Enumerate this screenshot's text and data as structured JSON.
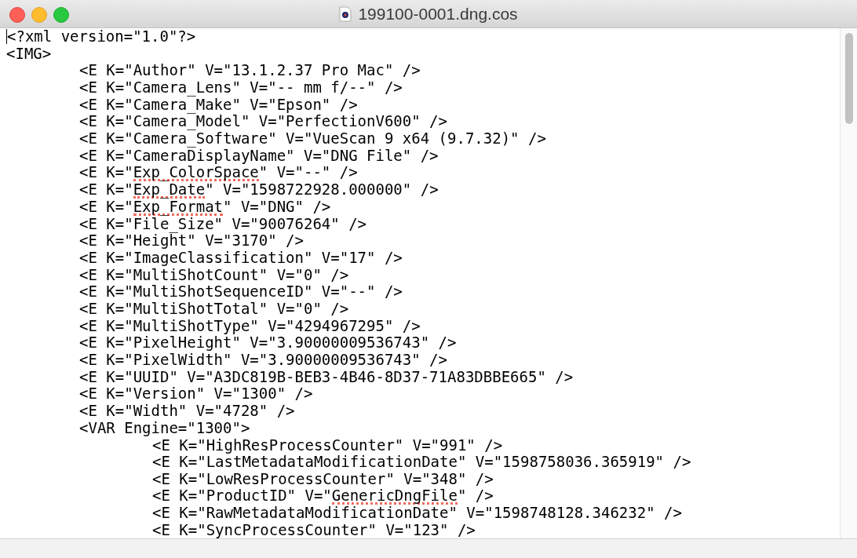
{
  "window": {
    "title": "199100-0001.dng.cos"
  },
  "document": {
    "lines": [
      {
        "text": "<?xml version=\"1.0\"?>"
      },
      {
        "text": "<IMG>",
        "children": [
          {
            "text": "<E K=\"Author\" V=\"13.1.2.37 Pro Mac\" />"
          },
          {
            "text": "<E K=\"Camera_Lens\" V=\"-- mm f/--\" />"
          },
          {
            "text": "<E K=\"Camera_Make\" V=\"Epson\" />"
          },
          {
            "text": "<E K=\"Camera_Model\" V=\"PerfectionV600\" />"
          },
          {
            "text": "<E K=\"Camera_Software\" V=\"VueScan 9 x64 (9.7.32)\" />"
          },
          {
            "text": "<E K=\"CameraDisplayName\" V=\"DNG File\" />"
          },
          {
            "parts": [
              {
                "text": "<E K=\"",
                "flagged": false
              },
              {
                "text": "Exp_ColorSpace",
                "flagged": true
              },
              {
                "text": "\" V=\"--\" />",
                "flagged": false
              }
            ]
          },
          {
            "parts": [
              {
                "text": "<E K=\"",
                "flagged": false
              },
              {
                "text": "Exp_Date",
                "flagged": true
              },
              {
                "text": "\" V=\"1598722928.000000\" />",
                "flagged": false
              }
            ]
          },
          {
            "parts": [
              {
                "text": "<E K=\"",
                "flagged": false
              },
              {
                "text": "Exp_Format",
                "flagged": true
              },
              {
                "text": "\" V=\"DNG\" />",
                "flagged": false
              }
            ]
          },
          {
            "text": "<E K=\"File_Size\" V=\"90076264\" />"
          },
          {
            "text": "<E K=\"Height\" V=\"3170\" />"
          },
          {
            "text": "<E K=\"ImageClassification\" V=\"17\" />"
          },
          {
            "text": "<E K=\"MultiShotCount\" V=\"0\" />"
          },
          {
            "text": "<E K=\"MultiShotSequenceID\" V=\"--\" />"
          },
          {
            "text": "<E K=\"MultiShotTotal\" V=\"0\" />"
          },
          {
            "text": "<E K=\"MultiShotType\" V=\"4294967295\" />"
          },
          {
            "text": "<E K=\"PixelHeight\" V=\"3.90000009536743\" />"
          },
          {
            "text": "<E K=\"PixelWidth\" V=\"3.90000009536743\" />"
          },
          {
            "text": "<E K=\"UUID\" V=\"A3DC819B-BEB3-4B46-8D37-71A83DBBE665\" />"
          },
          {
            "text": "<E K=\"Version\" V=\"1300\" />"
          },
          {
            "text": "<E K=\"Width\" V=\"4728\" />"
          },
          {
            "text": "<VAR Engine=\"1300\">",
            "children": [
              {
                "text": "<E K=\"HighResProcessCounter\" V=\"991\" />"
              },
              {
                "text": "<E K=\"LastMetadataModificationDate\" V=\"1598758036.365919\" />"
              },
              {
                "text": "<E K=\"LowResProcessCounter\" V=\"348\" />"
              },
              {
                "parts": [
                  {
                    "text": "<E K=\"ProductID\" V=\"",
                    "flagged": false
                  },
                  {
                    "text": "GenericDngFile",
                    "flagged": true
                  },
                  {
                    "text": "\" />",
                    "flagged": false
                  }
                ]
              },
              {
                "text": "<E K=\"RawMetadataModificationDate\" V=\"1598748128.346232\" />"
              },
              {
                "text": "<E K=\"SyncProcessCounter\" V=\"123\" />"
              }
            ]
          }
        ]
      }
    ]
  }
}
